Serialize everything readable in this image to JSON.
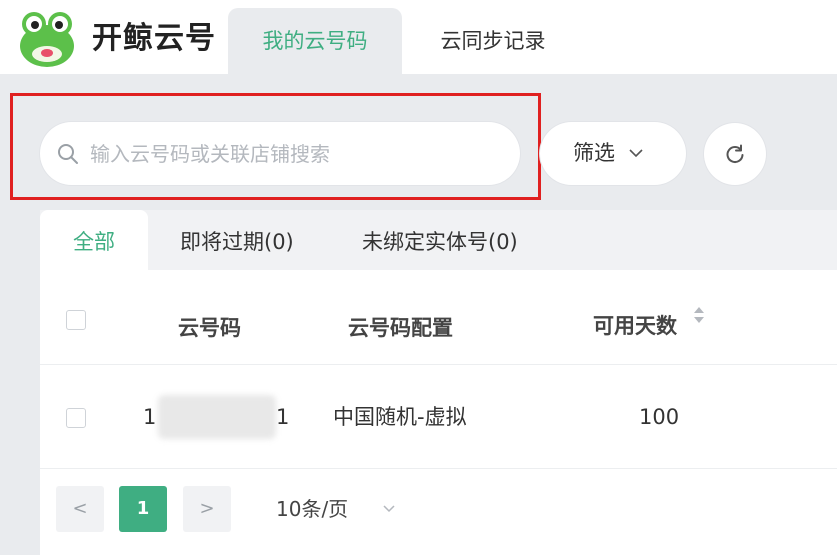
{
  "app": {
    "brand": "开鲸云号",
    "logo_icon": "frog-logo-icon"
  },
  "top_tabs": [
    {
      "label": "我的云号码",
      "active": true
    },
    {
      "label": "云同步记录",
      "active": false
    }
  ],
  "toolbar": {
    "search_placeholder": "输入云号码或关联店铺搜索",
    "search_value": "",
    "filter_label": "筛选",
    "refresh_icon": "refresh-icon"
  },
  "sub_tabs": [
    {
      "label": "全部",
      "active": true
    },
    {
      "label": "即将过期(0)",
      "active": false
    },
    {
      "label": "未绑定实体号(0)",
      "active": false
    }
  ],
  "table": {
    "columns": [
      "云号码",
      "云号码配置",
      "可用天数"
    ],
    "rows": [
      {
        "number_start": "1",
        "number_end": "1",
        "config": "中国随机-虚拟",
        "days": "100"
      }
    ]
  },
  "pagination": {
    "prev": "<",
    "current_page": "1",
    "next": ">",
    "page_size": "10条/页"
  },
  "colors": {
    "accent": "#3fae82",
    "highlight_border": "#e02020",
    "background": "#e9ebee"
  }
}
